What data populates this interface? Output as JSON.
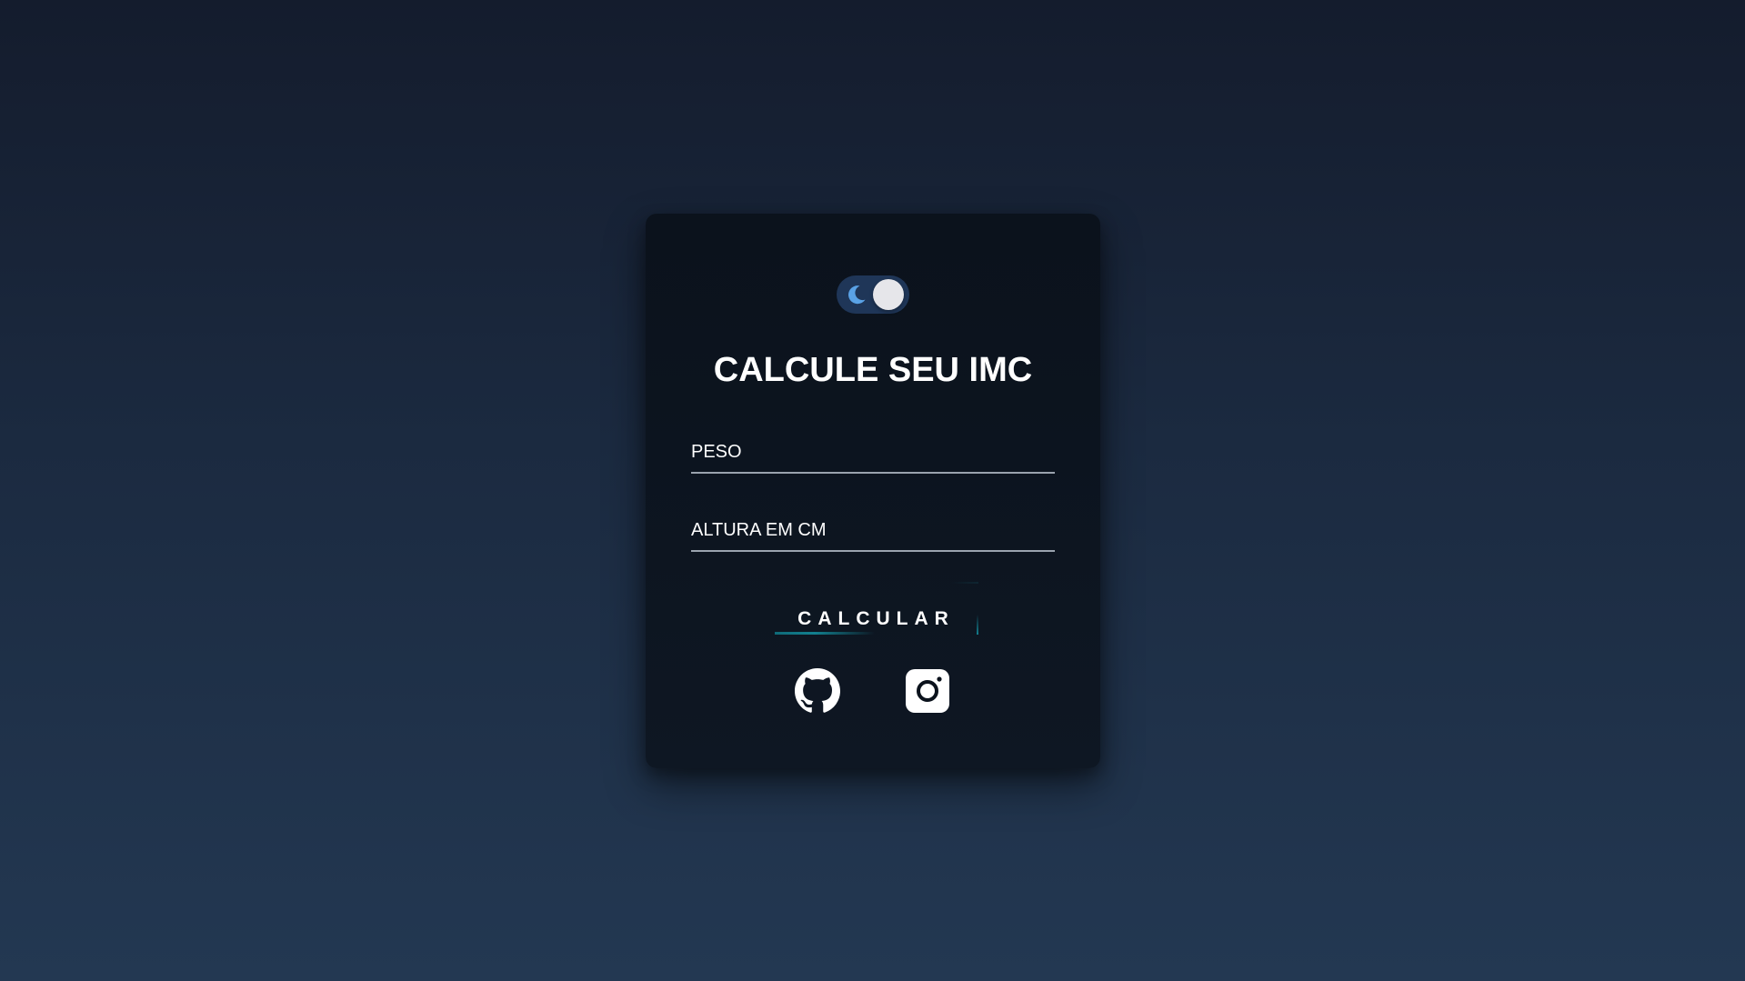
{
  "theme_toggle": {
    "state": "dark",
    "icon": "moon-icon"
  },
  "title": "CALCULE SEU IMC",
  "form": {
    "peso_placeholder": "PESO",
    "peso_value": "",
    "altura_placeholder": "ALTURA EM CM",
    "altura_value": ""
  },
  "button": {
    "label": "CALCULAR"
  },
  "social": [
    {
      "icon": "github-icon"
    },
    {
      "icon": "instagram-icon"
    }
  ],
  "colors": {
    "background_top": "#141c2d",
    "background_bottom": "#233852",
    "card": "#0b121c",
    "toggle_track": "#1f3658",
    "moon": "#5aa2e6",
    "accent": "#12808f",
    "text": "#ffffff"
  }
}
